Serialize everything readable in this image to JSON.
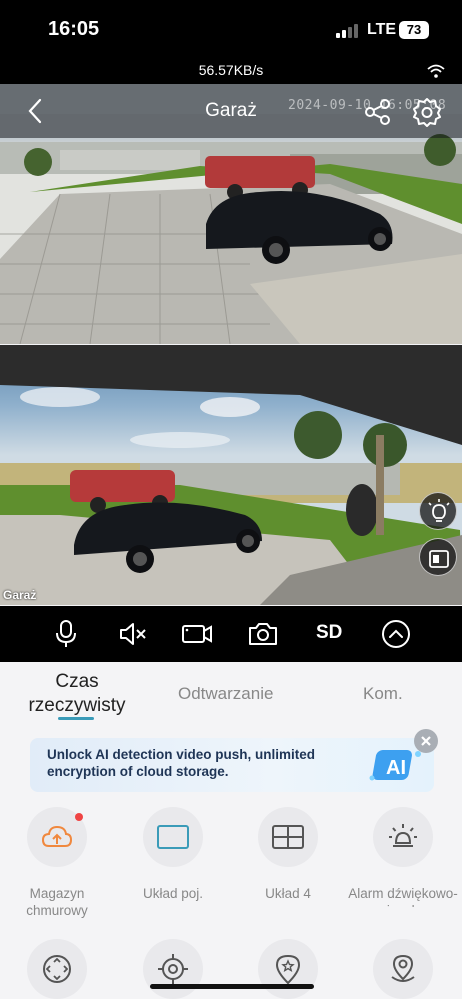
{
  "status_bar": {
    "time": "16:05",
    "network": "LTE",
    "battery": "73"
  },
  "net_bar": {
    "speed": "56.57KB/s"
  },
  "camera_header": {
    "title": "Garaż",
    "timestamp": "2024-09-10 16:05:08"
  },
  "feeds": [
    {
      "name": "top-camera-feed"
    },
    {
      "name": "bottom-camera-feed",
      "label": "Garaż"
    }
  ],
  "controls": {
    "sd_label": "SD"
  },
  "tabs": {
    "live": "Czas rzeczywisty",
    "playback": "Odtwarzanie",
    "comm": "Kom."
  },
  "banner": {
    "text": "Unlock AI detection video push, unlimited encryption of cloud storage."
  },
  "grid": [
    {
      "label": "Magazyn chmurowy",
      "icon": "cloud-upload-icon"
    },
    {
      "label": "Układ poj.",
      "icon": "single-layout-icon"
    },
    {
      "label": "Układ 4",
      "icon": "quad-layout-icon"
    },
    {
      "label": "Alarm dźwiękowo-wizualny",
      "icon": "alarm-light-icon"
    },
    {
      "label": "",
      "icon": "ptz-control-icon"
    },
    {
      "label": "",
      "icon": "target-icon"
    },
    {
      "label": "",
      "icon": "location-star-icon"
    },
    {
      "label": "",
      "icon": "location-icon"
    }
  ],
  "colors": {
    "accent": "#3a9bb8",
    "cloud_icon": "#f0883e",
    "banner_text": "#1f3556"
  }
}
